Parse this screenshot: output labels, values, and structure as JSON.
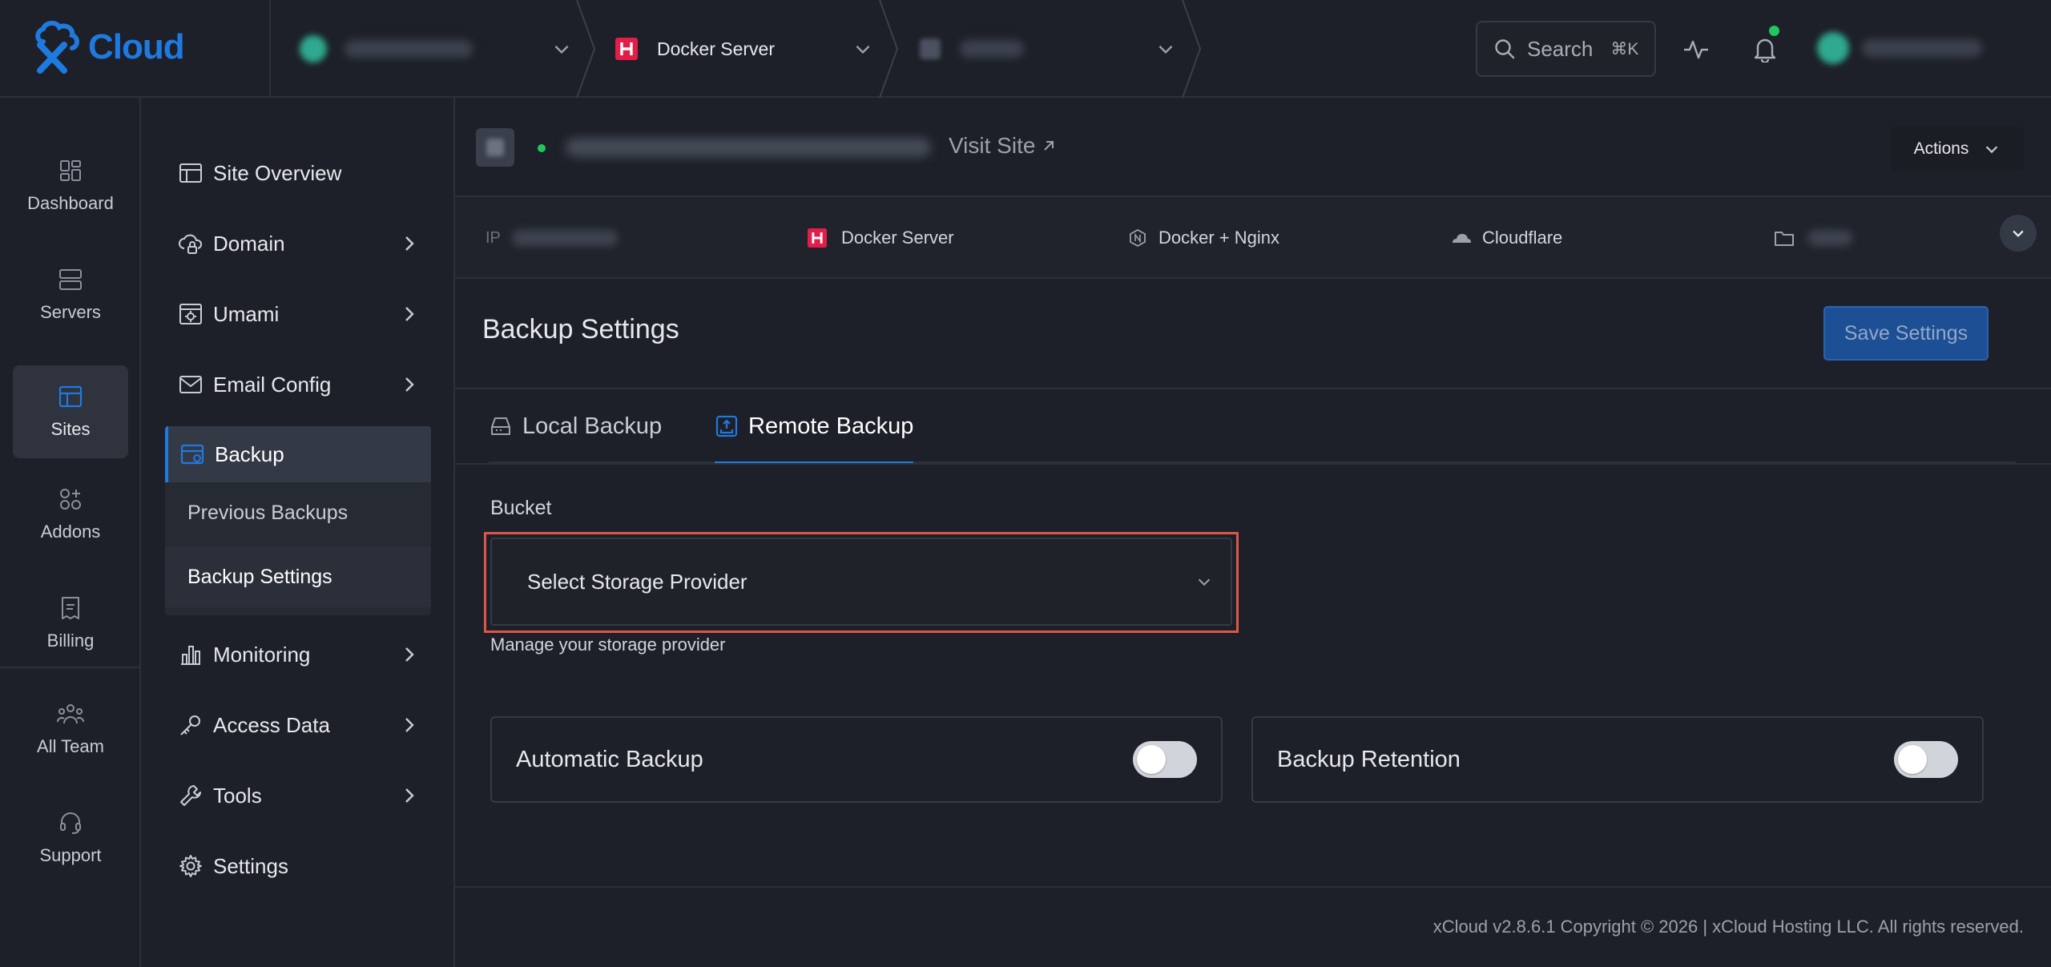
{
  "brand": {
    "logo_text": "Cloud",
    "accent": "#1f7ae0"
  },
  "topbar": {
    "breadcrumbs": [
      {
        "label": "",
        "icon": "server-avatar-icon"
      },
      {
        "label": "Docker Server",
        "icon": "docker-server-h-icon"
      },
      {
        "label": "",
        "icon": "site-icon"
      }
    ],
    "search": {
      "label": "Search",
      "shortcut": "⌘K"
    },
    "icons": [
      "activity-icon",
      "bell-icon"
    ],
    "notification_color": "#22c55e"
  },
  "rail": {
    "items": [
      {
        "label": "Dashboard",
        "icon": "dashboard-icon"
      },
      {
        "label": "Servers",
        "icon": "servers-icon"
      },
      {
        "label": "Sites",
        "icon": "sites-icon",
        "active": true
      },
      {
        "label": "Addons",
        "icon": "addons-icon"
      },
      {
        "label": "Billing",
        "icon": "billing-icon"
      },
      {
        "label": "All Team",
        "icon": "team-icon"
      },
      {
        "label": "Support",
        "icon": "headset-icon"
      }
    ]
  },
  "subnav": {
    "items": [
      {
        "label": "Site Overview",
        "icon": "layout-icon"
      },
      {
        "label": "Domain",
        "icon": "cloud-lock-icon"
      },
      {
        "label": "Umami",
        "icon": "analytics-gear-icon"
      },
      {
        "label": "Email Config",
        "icon": "mail-icon"
      },
      {
        "label": "Backup",
        "icon": "backup-icon"
      },
      {
        "label": "Monitoring",
        "icon": "bar-chart-icon"
      },
      {
        "label": "Access Data",
        "icon": "key-icon"
      },
      {
        "label": "Tools",
        "icon": "wrench-icon"
      },
      {
        "label": "Settings",
        "icon": "gear-icon"
      }
    ],
    "backup_children": [
      {
        "label": "Previous Backups"
      },
      {
        "label": "Backup Settings",
        "current": true
      }
    ]
  },
  "site": {
    "visit_label": "Visit Site",
    "actions_label": "Actions",
    "status_color": "#22c55e"
  },
  "info": {
    "ip_label": "IP",
    "server": "Docker Server",
    "stack": "Docker + Nginx",
    "dns": "Cloudflare"
  },
  "page": {
    "title": "Backup Settings",
    "save_label": "Save Settings",
    "tabs": [
      {
        "label": "Local Backup",
        "active": false
      },
      {
        "label": "Remote Backup",
        "active": true
      }
    ],
    "bucket_label": "Bucket",
    "select_placeholder": "Select Storage Provider",
    "helper": "Manage your storage provider",
    "toggles": [
      {
        "label": "Automatic Backup",
        "on": false
      },
      {
        "label": "Backup Retention",
        "on": false
      }
    ]
  },
  "footer": {
    "text": "xCloud v2.8.6.1 Copyright © 2026 | xCloud Hosting LLC. All rights reserved."
  }
}
